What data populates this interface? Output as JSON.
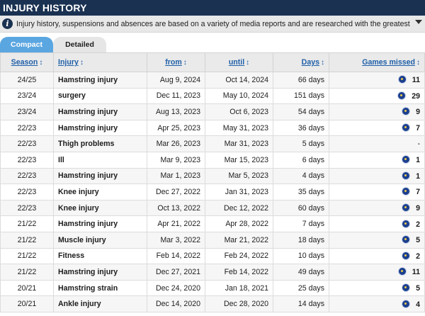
{
  "header": {
    "title": "INJURY HISTORY"
  },
  "notice": {
    "icon": "info-icon",
    "text": "Injury history, suspensions and absences are based on a variety of media reports and are researched with the greatest of care. If you should n..."
  },
  "tabs": [
    {
      "label": "Compact",
      "active": true
    },
    {
      "label": "Detailed",
      "active": false
    }
  ],
  "columns": {
    "season": "Season",
    "injury": "Injury",
    "from": "from",
    "until": "until",
    "days": "Days",
    "games": "Games missed",
    "sort_glyph": "↕"
  },
  "rows": [
    {
      "season": "24/25",
      "injury": "Hamstring injury",
      "from": "Aug 9, 2024",
      "until": "Oct 14, 2024",
      "days": "66 days",
      "games": "11",
      "crest": true
    },
    {
      "season": "23/24",
      "injury": "surgery",
      "from": "Dec 11, 2023",
      "until": "May 10, 2024",
      "days": "151 days",
      "games": "29",
      "crest": true
    },
    {
      "season": "23/24",
      "injury": "Hamstring injury",
      "from": "Aug 13, 2023",
      "until": "Oct 6, 2023",
      "days": "54 days",
      "games": "9",
      "crest": true
    },
    {
      "season": "22/23",
      "injury": "Hamstring injury",
      "from": "Apr 25, 2023",
      "until": "May 31, 2023",
      "days": "36 days",
      "games": "7",
      "crest": true
    },
    {
      "season": "22/23",
      "injury": "Thigh problems",
      "from": "Mar 26, 2023",
      "until": "Mar 31, 2023",
      "days": "5 days",
      "games": "-",
      "crest": false
    },
    {
      "season": "22/23",
      "injury": "Ill",
      "from": "Mar 9, 2023",
      "until": "Mar 15, 2023",
      "days": "6 days",
      "games": "1",
      "crest": true
    },
    {
      "season": "22/23",
      "injury": "Hamstring injury",
      "from": "Mar 1, 2023",
      "until": "Mar 5, 2023",
      "days": "4 days",
      "games": "1",
      "crest": true
    },
    {
      "season": "22/23",
      "injury": "Knee injury",
      "from": "Dec 27, 2022",
      "until": "Jan 31, 2023",
      "days": "35 days",
      "games": "7",
      "crest": true
    },
    {
      "season": "22/23",
      "injury": "Knee injury",
      "from": "Oct 13, 2022",
      "until": "Dec 12, 2022",
      "days": "60 days",
      "games": "9",
      "crest": true
    },
    {
      "season": "21/22",
      "injury": "Hamstring injury",
      "from": "Apr 21, 2022",
      "until": "Apr 28, 2022",
      "days": "7 days",
      "games": "2",
      "crest": true
    },
    {
      "season": "21/22",
      "injury": "Muscle injury",
      "from": "Mar 3, 2022",
      "until": "Mar 21, 2022",
      "days": "18 days",
      "games": "5",
      "crest": true
    },
    {
      "season": "21/22",
      "injury": "Fitness",
      "from": "Feb 14, 2022",
      "until": "Feb 24, 2022",
      "days": "10 days",
      "games": "2",
      "crest": true
    },
    {
      "season": "21/22",
      "injury": "Hamstring injury",
      "from": "Dec 27, 2021",
      "until": "Feb 14, 2022",
      "days": "49 days",
      "games": "11",
      "crest": true
    },
    {
      "season": "20/21",
      "injury": "Hamstring strain",
      "from": "Dec 24, 2020",
      "until": "Jan 18, 2021",
      "days": "25 days",
      "games": "5",
      "crest": true
    },
    {
      "season": "20/21",
      "injury": "Ankle injury",
      "from": "Dec 14, 2020",
      "until": "Dec 28, 2020",
      "days": "14 days",
      "games": "4",
      "crest": true
    }
  ],
  "colors": {
    "header_bg": "#1a3151",
    "tab_active": "#5aa6e1",
    "link": "#1f5fa8",
    "crest": "#1b3f8f"
  }
}
